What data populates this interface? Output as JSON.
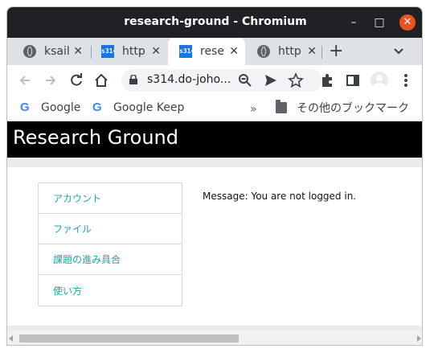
{
  "window": {
    "title": "research-ground - Chromium",
    "minimize_glyph": "–",
    "maximize_glyph": "□",
    "close_glyph": "✕"
  },
  "tabs": [
    {
      "label": "ksail",
      "icon": "globe-icon",
      "active": false,
      "close_glyph": "✕"
    },
    {
      "label": "http",
      "icon": "s314-favicon",
      "active": false,
      "close_glyph": "✕"
    },
    {
      "label": "rese",
      "icon": "s314-favicon",
      "active": true,
      "close_glyph": "✕"
    },
    {
      "label": "http",
      "icon": "globe-icon",
      "active": false,
      "close_glyph": "✕"
    }
  ],
  "favicon_text": "s314",
  "toolbar": {
    "url": "s314.do-joho...",
    "new_tab_glyph": "+"
  },
  "bookmarks": {
    "items": [
      {
        "label": "Google",
        "icon": "google-icon"
      },
      {
        "label": "Google Keep",
        "icon": "google-icon"
      }
    ],
    "overflow_glyph": "»",
    "other_folder": "その他のブックマーク",
    "google_glyph": "G"
  },
  "site": {
    "title": "Research Ground",
    "menu": [
      {
        "label": "アカウント"
      },
      {
        "label": "ファイル"
      },
      {
        "label": "課題の進み具合"
      },
      {
        "label": "使い方"
      }
    ],
    "message": "Message: You are not logged in."
  },
  "colors": {
    "header_bg": "#000000",
    "link": "#1ea7a6",
    "titlebar": "#202124",
    "close_button": "#e95420"
  }
}
